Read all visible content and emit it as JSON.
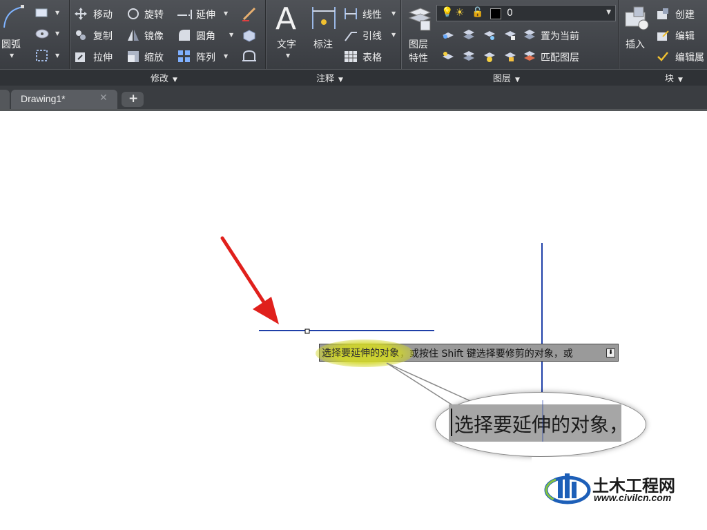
{
  "ribbon": {
    "draw_panel": {
      "arc_label": "圆弧"
    },
    "modify_panel": {
      "title": "修改",
      "items": {
        "move": "移动",
        "rotate": "旋转",
        "extend": "延伸",
        "copy": "复制",
        "mirror": "镜像",
        "fillet": "圆角",
        "stretch": "拉伸",
        "scale": "缩放",
        "array": "阵列"
      }
    },
    "annotation_panel": {
      "title": "注释",
      "text": "文字",
      "dimension": "标注",
      "linetype": "线性",
      "leader": "引线",
      "table": "表格"
    },
    "layers_panel": {
      "title": "图层",
      "layer_props_line1": "图层",
      "layer_props_line2": "特性",
      "current_layer": "0",
      "set_current": "置为当前",
      "match_layer": "匹配图层"
    },
    "block_panel": {
      "title": "块",
      "insert": "插入",
      "create": "创建",
      "edit": "编辑",
      "edit_attr": "编辑属"
    }
  },
  "tabs": {
    "active": "Drawing1*",
    "new_tab_symbol": "+"
  },
  "command_prompt": {
    "text_highlighted": "选择要延伸的对象",
    "text_rest": "，或按住 Shift 键选择要修剪的对象，或"
  },
  "zoom_callout": {
    "text": "选择要延伸的对象，"
  },
  "watermark": {
    "brand": "土木工程网",
    "url": "www.civilcn.com"
  },
  "colors": {
    "ribbon_bg": "#3c3f44",
    "line_blue": "#1f3fa8",
    "arrow_red": "#e0201c",
    "highlight": "#d2d728"
  }
}
